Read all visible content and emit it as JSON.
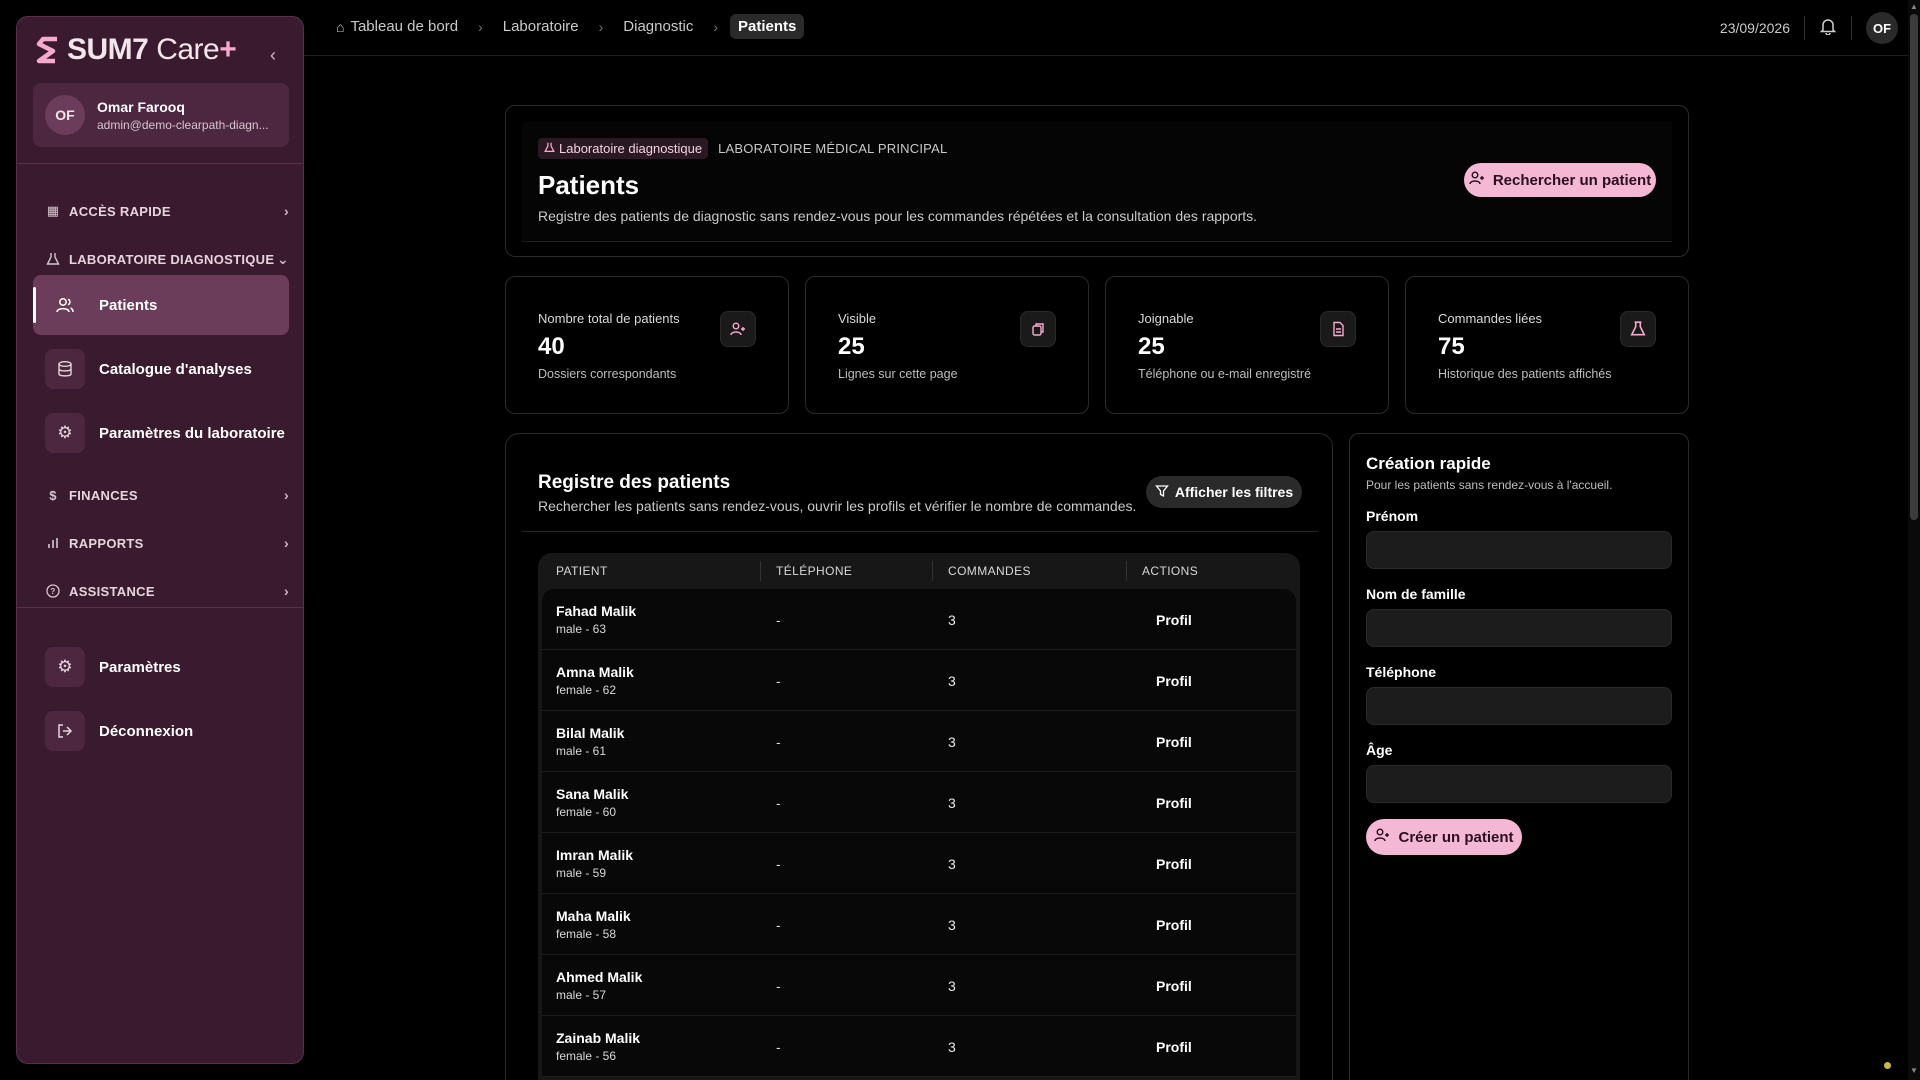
{
  "brand": {
    "name": "SUM7",
    "product": "Care",
    "plus": "+"
  },
  "user": {
    "initials": "OF",
    "name": "Omar Farooq",
    "email": "admin@demo-clearpath-diagn..."
  },
  "sidebar": {
    "quick_access": "ACCÈS RAPIDE",
    "lab_section": "LABORATOIRE DIAGNOSTIQUE",
    "items": [
      {
        "label": "Patients",
        "icon": "users-icon",
        "active": true
      },
      {
        "label": "Catalogue d'analyses",
        "icon": "database-icon"
      },
      {
        "label": "Paramètres du laboratoire",
        "icon": "gear-icon"
      }
    ],
    "finances": "FINANCES",
    "reports": "RAPPORTS",
    "support": "ASSISTANCE",
    "settings": "Paramètres",
    "logout": "Déconnexion"
  },
  "breadcrumb": [
    "Tableau de bord",
    "Laboratoire",
    "Diagnostic",
    "Patients"
  ],
  "topbar": {
    "date": "23/09/2026",
    "initials": "OF"
  },
  "header": {
    "tag": "Laboratoire diagnostique",
    "subtag": "LABORATOIRE MÉDICAL PRINCIPAL",
    "title": "Patients",
    "description": "Registre des patients de diagnostic sans rendez-vous pour les commandes répétées et la consultation des rapports.",
    "search_button": "Rechercher un patient"
  },
  "stats": [
    {
      "label": "Nombre total de patients",
      "value": "40",
      "sub": "Dossiers correspondants",
      "icon": "user-plus-icon"
    },
    {
      "label": "Visible",
      "value": "25",
      "sub": "Lignes sur cette page",
      "icon": "copy-icon"
    },
    {
      "label": "Joignable",
      "value": "25",
      "sub": "Téléphone ou e-mail enregistré",
      "icon": "document-icon"
    },
    {
      "label": "Commandes liées",
      "value": "75",
      "sub": "Historique des patients affichés",
      "icon": "flask-icon"
    }
  ],
  "registry": {
    "title": "Registre des patients",
    "description": "Rechercher les patients sans rendez-vous, ouvrir les profils et vérifier le nombre de commandes.",
    "filter_button": "Afficher les filtres",
    "columns": [
      "PATIENT",
      "TÉLÉPHONE",
      "COMMANDES",
      "ACTIONS"
    ],
    "rows": [
      {
        "name": "Fahad Malik",
        "meta": "male - 63",
        "phone": "-",
        "orders": "3",
        "action": "Profil"
      },
      {
        "name": "Amna Malik",
        "meta": "female - 62",
        "phone": "-",
        "orders": "3",
        "action": "Profil"
      },
      {
        "name": "Bilal Malik",
        "meta": "male - 61",
        "phone": "-",
        "orders": "3",
        "action": "Profil"
      },
      {
        "name": "Sana Malik",
        "meta": "female - 60",
        "phone": "-",
        "orders": "3",
        "action": "Profil"
      },
      {
        "name": "Imran Malik",
        "meta": "male - 59",
        "phone": "-",
        "orders": "3",
        "action": "Profil"
      },
      {
        "name": "Maha Malik",
        "meta": "female - 58",
        "phone": "-",
        "orders": "3",
        "action": "Profil"
      },
      {
        "name": "Ahmed Malik",
        "meta": "male - 57",
        "phone": "-",
        "orders": "3",
        "action": "Profil"
      },
      {
        "name": "Zainab Malik",
        "meta": "female - 56",
        "phone": "-",
        "orders": "3",
        "action": "Profil"
      }
    ]
  },
  "quick_create": {
    "title": "Création rapide",
    "description": "Pour les patients sans rendez-vous à l'accueil.",
    "fields": [
      {
        "label": "Prénom",
        "value": ""
      },
      {
        "label": "Nom de famille",
        "value": ""
      },
      {
        "label": "Téléphone",
        "value": ""
      },
      {
        "label": "Âge",
        "value": ""
      }
    ],
    "create_button": "Créer un patient"
  },
  "colors": {
    "accent": "#f4b8d4",
    "sidebar": "#3a1a2e",
    "sidebar_active": "#6c3d5a"
  }
}
